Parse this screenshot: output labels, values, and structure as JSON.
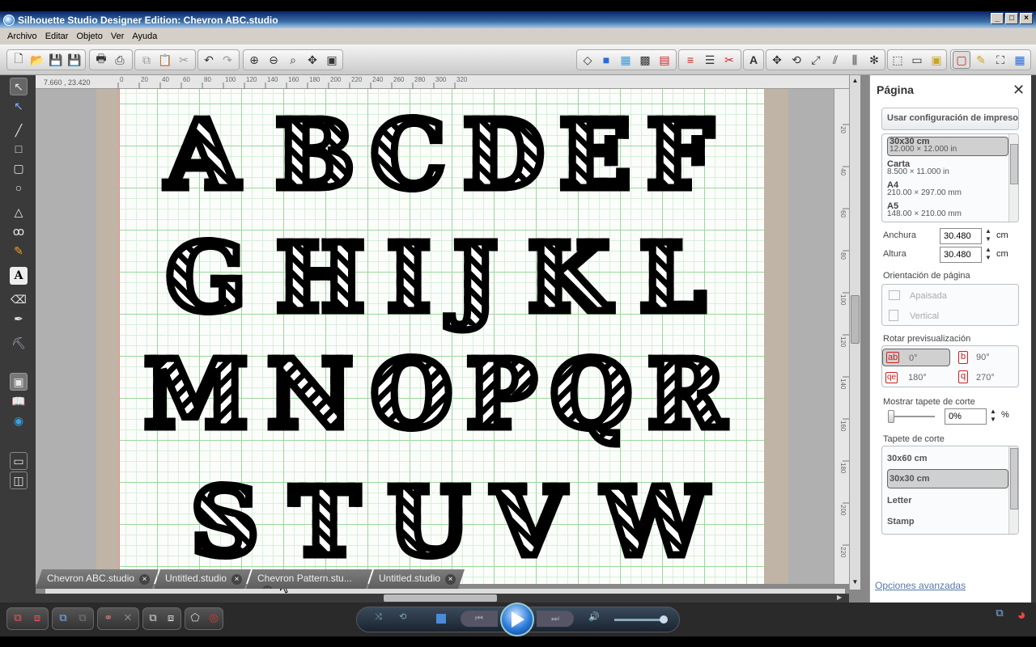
{
  "window": {
    "title": "Silhouette Studio Designer Edition: Chevron ABC.studio"
  },
  "menu": [
    "Archivo",
    "Editar",
    "Objeto",
    "Ver",
    "Ayuda"
  ],
  "ruler": {
    "coords": "7.660 , 23.420",
    "h_ticks": [
      "0",
      "20",
      "40",
      "60",
      "80",
      "100",
      "120",
      "140",
      "160",
      "180",
      "200",
      "220",
      "240",
      "260",
      "280",
      "300",
      "320"
    ],
    "v_ticks": [
      "20",
      "40",
      "60",
      "80",
      "100",
      "120",
      "140",
      "160",
      "180",
      "200",
      "220"
    ]
  },
  "canvas": {
    "letters": [
      "A",
      "B",
      "C",
      "D",
      "E",
      "F",
      "G",
      "H",
      "I",
      "J",
      "K",
      "L",
      "M",
      "N",
      "O",
      "P",
      "Q",
      "R",
      "S",
      "T",
      "U",
      "V",
      "W"
    ]
  },
  "tabs": [
    {
      "label": "Chevron ABC.studio",
      "active": true
    },
    {
      "label": "Untitled.studio",
      "active": false
    },
    {
      "label": "Chevron Pattern.stu...",
      "active": false
    },
    {
      "label": "Untitled.studio",
      "active": false
    }
  ],
  "panel": {
    "title": "Página",
    "printer_button": "Usar configuración de impresora",
    "page_sizes": [
      {
        "name": "30x30 cm",
        "dims": "12.000 × 12.000 in",
        "selected": true
      },
      {
        "name": "Carta",
        "dims": "8.500 × 11.000 in",
        "selected": false
      },
      {
        "name": "A4",
        "dims": "210.00 × 297.00 mm",
        "selected": false
      },
      {
        "name": "A5",
        "dims": "148.00 × 210.00 mm",
        "selected": false
      }
    ],
    "width_label": "Anchura",
    "width_value": "30.480",
    "height_label": "Altura",
    "height_value": "30.480",
    "unit": "cm",
    "orientation_label": "Orientación de página",
    "orientation_landscape": "Apaisada",
    "orientation_portrait": "Vertical",
    "rotate_label": "Rotar previsualización",
    "rotations": [
      "0°",
      "90°",
      "180°",
      "270°"
    ],
    "rotate_selected": "0°",
    "mat_label": "Mostrar tapete de corte",
    "mat_percent": "0%",
    "percent_sign": "%",
    "cutting_mat_label": "Tapete de corte",
    "cutting_mats": [
      {
        "name": "30x60 cm",
        "selected": false
      },
      {
        "name": "30x30 cm",
        "selected": true
      },
      {
        "name": "Letter",
        "selected": false
      },
      {
        "name": "Stamp",
        "selected": false
      }
    ],
    "advanced_link": "Opciones avanzadas"
  }
}
